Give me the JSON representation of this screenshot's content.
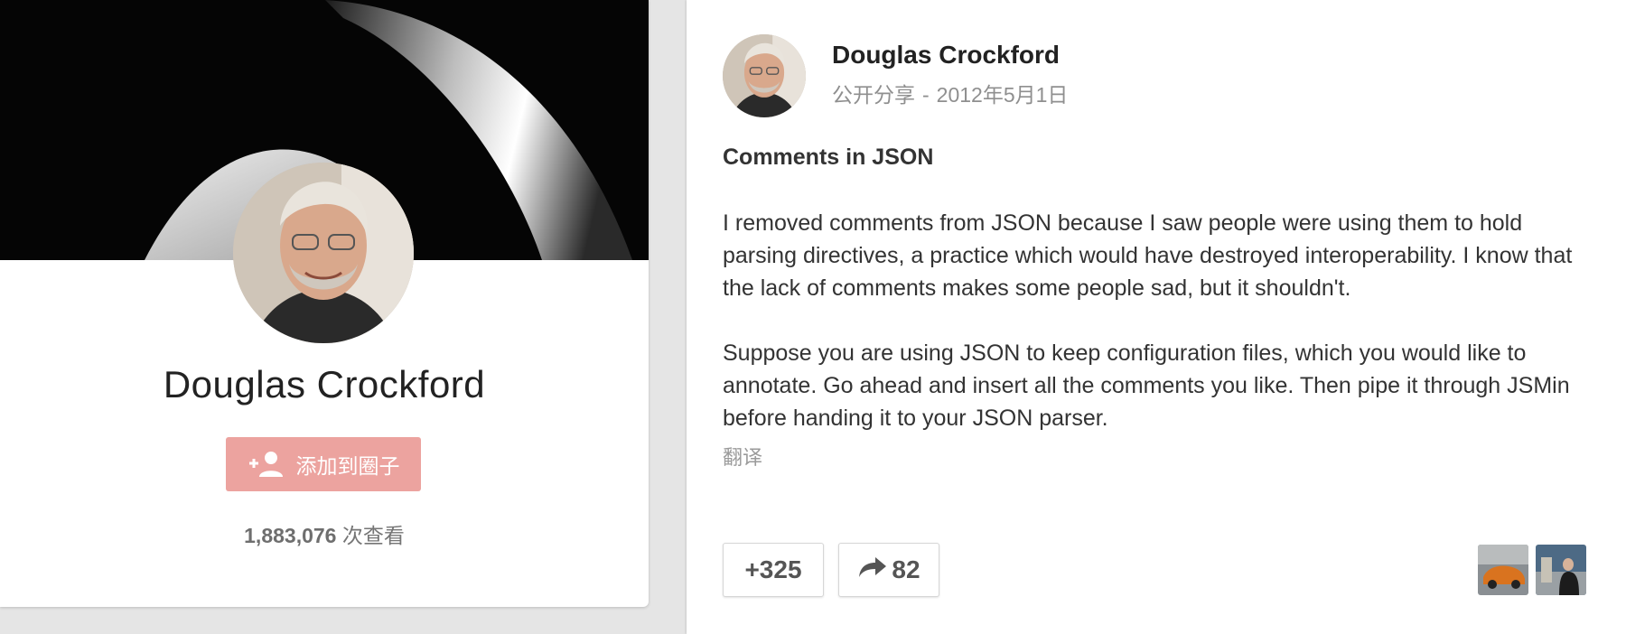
{
  "profile": {
    "name": "Douglas Crockford",
    "add_button_label": "添加到圈子",
    "views_count": "1,883,076",
    "views_label": "次查看"
  },
  "post": {
    "author": "Douglas Crockford",
    "visibility": "公开分享",
    "separator": "-",
    "date": "2012年5月1日",
    "title": "Comments in JSON",
    "paragraphs": [
      "I removed comments from JSON because I saw people were using them to hold parsing directives, a practice which would have destroyed interoperability. I know that the lack of comments makes some people sad, but it shouldn't.",
      "Suppose you are using JSON to keep configuration files, which you would like to annotate. Go ahead and insert all the comments you like. Then pipe it through JSMin before handing it to your JSON parser."
    ],
    "translate_label": "翻译",
    "plus_count": "+325",
    "share_count": "82"
  },
  "icons": {
    "add_person": "add-person-icon",
    "share": "share-arrow-icon"
  },
  "colors": {
    "add_button_bg": "#eca39f",
    "cover_bg": "#050505",
    "page_bg": "#e5e5e5"
  }
}
